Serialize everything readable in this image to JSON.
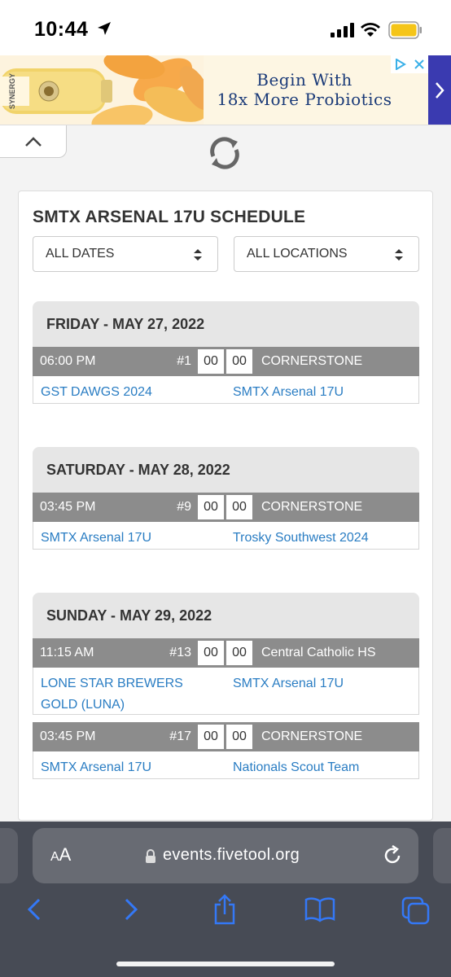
{
  "status_bar": {
    "time": "10:44"
  },
  "ad": {
    "headline_line1": "Begin With",
    "headline_line2": "18x More Probiotics",
    "brand_text": "SYNERGY"
  },
  "url_bar": {
    "text_size_label": "AA",
    "url": "events.fivetool.org"
  },
  "schedule": {
    "title": "SMTX ARSENAL 17U SCHEDULE",
    "date_filter": "ALL DATES",
    "location_filter": "ALL LOCATIONS",
    "days": [
      {
        "header": "FRIDAY - MAY 27, 2022",
        "games": [
          {
            "time": "06:00 PM",
            "number": "#1",
            "score_home": "00",
            "score_away": "00",
            "location": "CORNERSTONE",
            "team_home": "GST DAWGS 2024",
            "team_away": "SMTX Arsenal 17U"
          }
        ]
      },
      {
        "header": "SATURDAY - MAY 28, 2022",
        "games": [
          {
            "time": "03:45 PM",
            "number": "#9",
            "score_home": "00",
            "score_away": "00",
            "location": "CORNERSTONE",
            "team_home": "SMTX Arsenal 17U",
            "team_away": "Trosky Southwest 2024"
          }
        ]
      },
      {
        "header": "SUNDAY - MAY 29, 2022",
        "games": [
          {
            "time": "11:15 AM",
            "number": "#13",
            "score_home": "00",
            "score_away": "00",
            "location": "Central Catholic HS",
            "team_home": "LONE STAR BREWERS GOLD (LUNA)",
            "team_away": "SMTX Arsenal 17U"
          },
          {
            "time": "03:45 PM",
            "number": "#17",
            "score_home": "00",
            "score_away": "00",
            "location": "CORNERSTONE",
            "team_home": "SMTX Arsenal 17U",
            "team_away": "Nationals Scout Team"
          }
        ]
      }
    ]
  },
  "colors": {
    "link": "#2a7dc3",
    "game_row": "#8c8c8c",
    "day_header": "#e6e6e6",
    "ios_blue": "#3478f6"
  }
}
